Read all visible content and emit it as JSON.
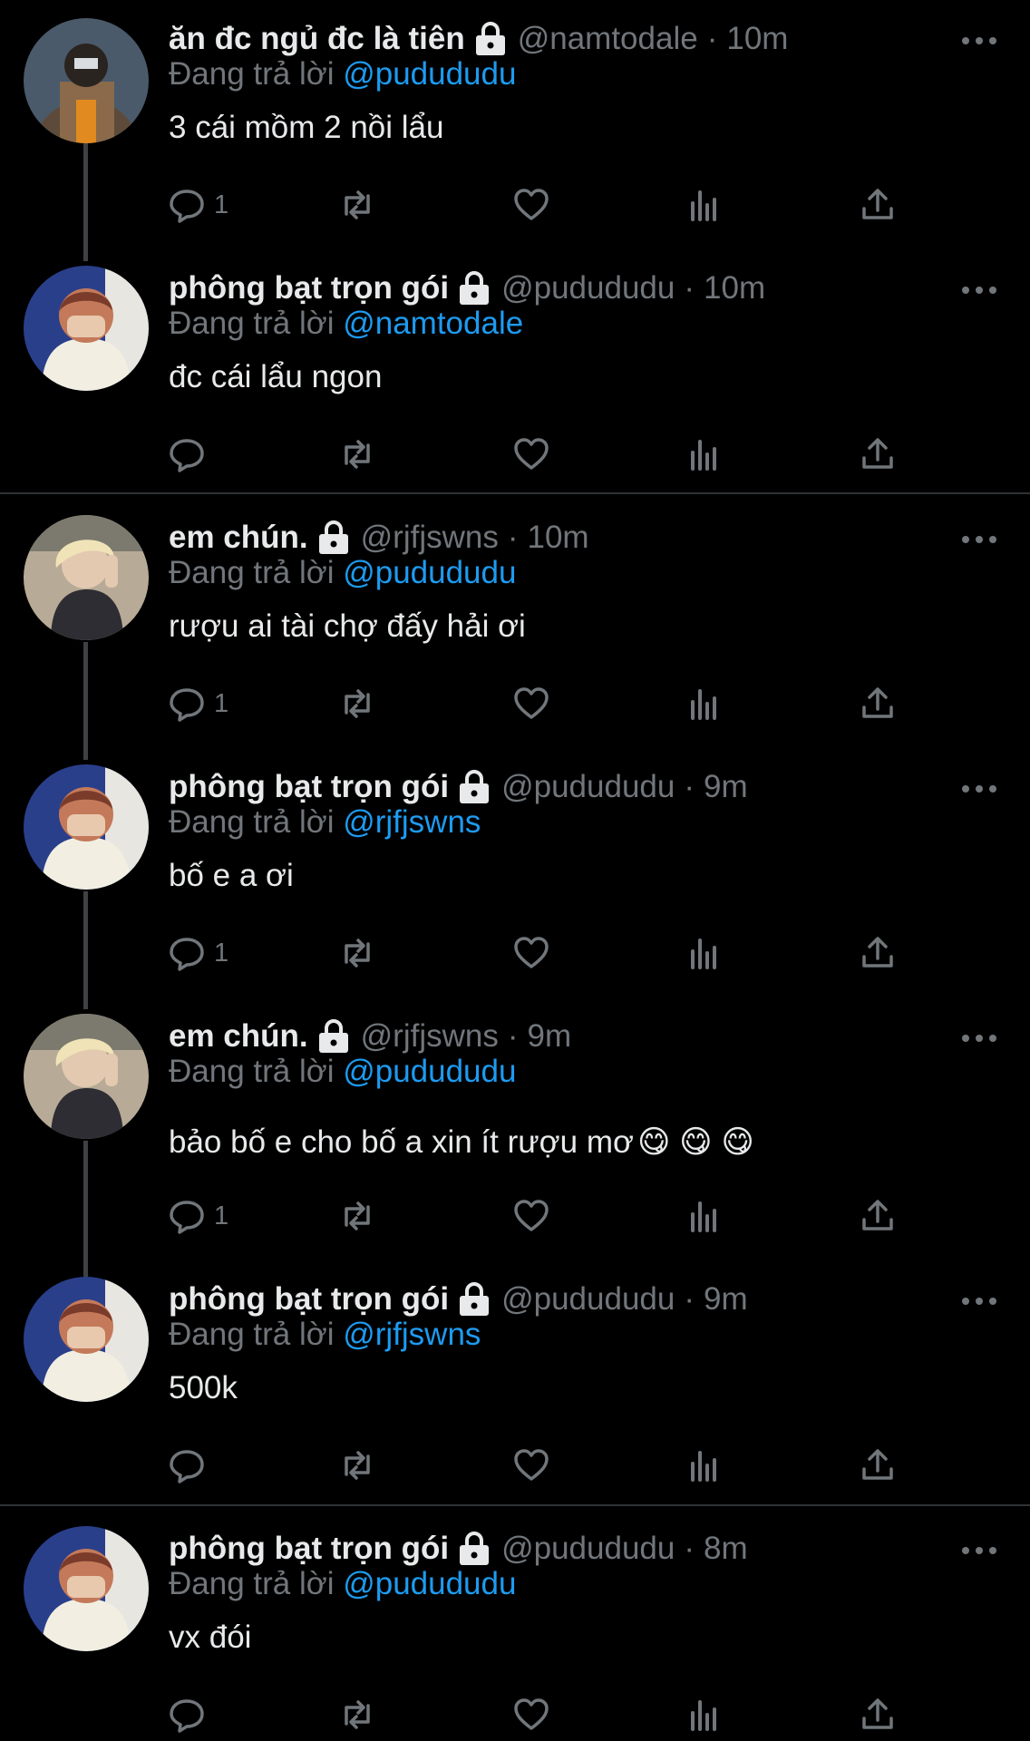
{
  "tweets": [
    {
      "name": "ăn đc ngủ đc là tiên",
      "handle": "@namtodale",
      "dot": "·",
      "time": "10m",
      "replying_prefix": "Đang trả lời",
      "mention": "@pudududu",
      "text": "3 cái mồm 2 nồi lẩu",
      "reply_count": "1",
      "avatar": "man-hoodie-avatar"
    },
    {
      "name": "phông bạt trọn gói",
      "handle": "@pudududu",
      "dot": "·",
      "time": "10m",
      "replying_prefix": "Đang trả lời",
      "mention": "@namtodale",
      "text": "đc cái lẩu ngon",
      "reply_count": "",
      "avatar": "covering-face-avatar"
    },
    {
      "name": "em chún.",
      "handle": "@rjfjswns",
      "dot": "·",
      "time": "10m",
      "replying_prefix": "Đang trả lời",
      "mention": "@pudududu",
      "text": "rượu ai tài chợ đấy hải ơi",
      "reply_count": "1",
      "avatar": "blonde-side-avatar"
    },
    {
      "name": "phông bạt trọn gói",
      "handle": "@pudududu",
      "dot": "·",
      "time": "9m",
      "replying_prefix": "Đang trả lời",
      "mention": "@rjfjswns",
      "text": "bố e a ơi",
      "reply_count": "1",
      "avatar": "covering-face-avatar"
    },
    {
      "name": "em chún.",
      "handle": "@rjfjswns",
      "dot": "·",
      "time": "9m",
      "replying_prefix": "Đang trả lời",
      "mention": "@pudududu",
      "text": "bảo bố e cho bố a xin ít rượu mơ",
      "reply_count": "1",
      "avatar": "blonde-side-avatar",
      "emoji": "😋 😋 😋"
    },
    {
      "name": "phông bạt trọn gói",
      "handle": "@pudududu",
      "dot": "·",
      "time": "9m",
      "replying_prefix": "Đang trả lời",
      "mention": "@rjfjswns",
      "text": "500k",
      "reply_count": "",
      "avatar": "covering-face-avatar"
    },
    {
      "name": "phông bạt trọn gói",
      "handle": "@pudududu",
      "dot": "·",
      "time": "8m",
      "replying_prefix": "Đang trả lời",
      "mention": "@pudududu",
      "text": "vx đói",
      "reply_count": "",
      "avatar": "covering-face-avatar"
    }
  ],
  "icons": {
    "reply": "reply-icon",
    "retweet": "retweet-icon",
    "like": "heart-icon",
    "views": "views-icon",
    "share": "share-icon",
    "more": "more-icon",
    "lock": "lock-icon"
  },
  "colors": {
    "background": "#000000",
    "text": "#e7e9ea",
    "muted": "#71767b",
    "link": "#1d9bf0",
    "divider": "#2f3336",
    "thread_line": "#3e4144"
  }
}
